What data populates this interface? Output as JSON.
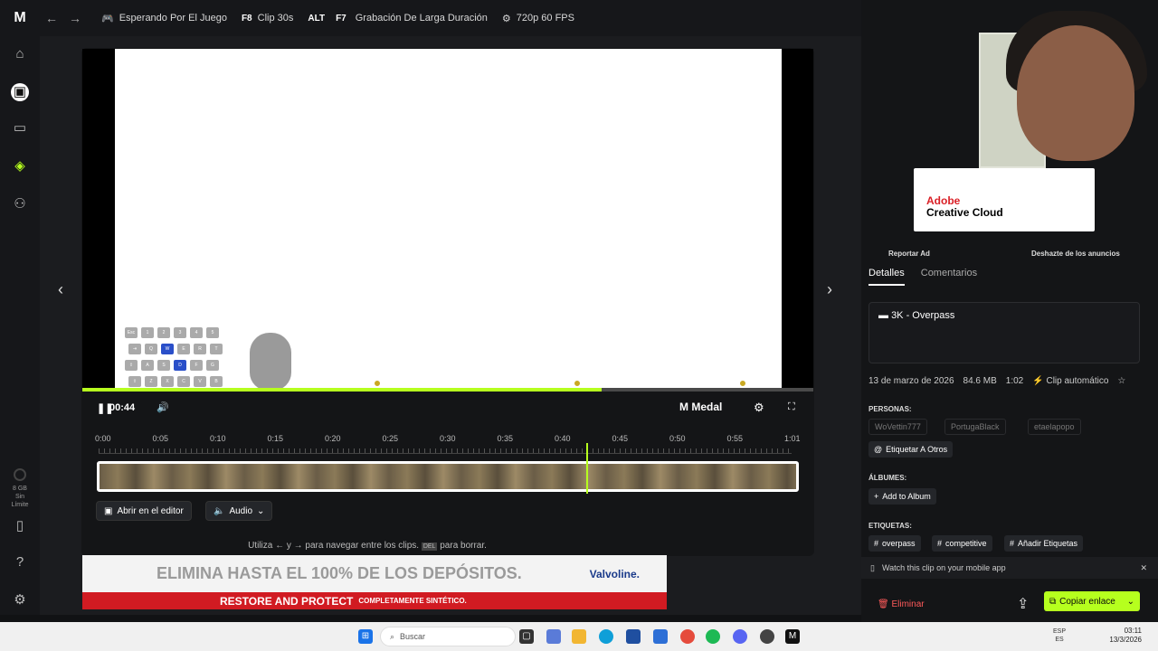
{
  "topbar": {
    "logo": "M",
    "back": "←",
    "forward": "→",
    "status": "Esperando Por El Juego",
    "clip_key": "F8",
    "clip_label": "Clip 30s",
    "long_key_1": "ALT",
    "long_key_2": "F7",
    "long_label": "Grabación De Larga Duración",
    "quality": "720p 60 FPS"
  },
  "sidebar": {
    "storage_line1": "8 GB",
    "storage_line2": "Sin",
    "storage_line3": "Límite"
  },
  "player": {
    "time": "00:44",
    "brand": "Medal",
    "progress_fraction": 0.71,
    "tick_labels": [
      "0:00",
      "0:05",
      "0:10",
      "0:15",
      "0:20",
      "0:25",
      "0:30",
      "0:35",
      "0:40",
      "0:45",
      "0:50",
      "0:55",
      "1:01"
    ],
    "keyboard_keys": [
      [
        "Esc",
        "1",
        "2",
        "3",
        "4",
        "5"
      ],
      [
        "⇥",
        "Q",
        "W",
        "E",
        "R",
        "T"
      ],
      [
        "⇪",
        "A",
        "S",
        "D",
        "F",
        "G"
      ],
      [
        "⇧",
        "Z",
        "X",
        "C",
        "V",
        "B"
      ]
    ],
    "active_keys": [
      "W",
      "D"
    ]
  },
  "buttons": {
    "open_editor": "Abrir en el editor",
    "audio": "Audio"
  },
  "hint": {
    "text_1": "Utiliza",
    "text_2": "y",
    "text_3": "para navegar entre los clips.",
    "key_del": "DEL",
    "text_4": "para borrar."
  },
  "ad_banner": {
    "headline": "ELIMINA HASTA EL 100% DE LOS DEPÓSITOS.",
    "brand": "Valvoline.",
    "tagline": "RESTORE AND PROTECT",
    "sub": "COMPLETAMENTE SINTÉTICO."
  },
  "right_panel": {
    "ad_title_1": "Adobe",
    "ad_title_2": "Creative Cloud",
    "report_ad": "Reportar Ad",
    "remove_ads": "Deshazte de los anuncios",
    "tab_details": "Detalles",
    "tab_comments": "Comentarios",
    "clip_title": "3K - Overpass",
    "date": "13 de marzo de 2026",
    "size": "84.6 MB",
    "duration": "1:02",
    "clip_type": "Clip automático",
    "people_label": "PERSONAS:",
    "people": [
      "WoVettin777",
      "PortugaBlack",
      "etaelapopo"
    ],
    "tag_others": "Etiquetar A Otros",
    "albums_label": "ÁLBUMES:",
    "add_album": "Add to Album",
    "tags_label": "ETIQUETAS:",
    "tags": [
      "overpass",
      "competitive"
    ],
    "add_tags": "Añadir Etiquetas",
    "mobile_text": "Watch this clip on your mobile app",
    "delete": "Eliminar",
    "copy_link": "Copiar enlace"
  },
  "taskbar": {
    "search": "Buscar",
    "lang_1": "ESP",
    "lang_2": "ES",
    "time": "03:11",
    "date": "13/3/2026"
  }
}
